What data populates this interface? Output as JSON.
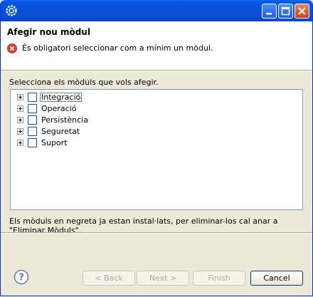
{
  "header": {
    "title": "Afegir nou mòdul",
    "error_message": "És obligatori seleccionar com a mínim un mòdul."
  },
  "prompt": "Selecciona els mòduls que vols afegir.",
  "tree": {
    "items": [
      {
        "label": "Integració",
        "checked": false
      },
      {
        "label": "Operació",
        "checked": false
      },
      {
        "label": "Persistència",
        "checked": false
      },
      {
        "label": "Seguretat",
        "checked": false
      },
      {
        "label": "Suport",
        "checked": false
      }
    ]
  },
  "info": "Els mòduls en negreta ja estan instal·lats, per eliminar-los cal anar a \"Eliminar Mòduls\".",
  "buttons": {
    "back": "< Back",
    "next": "Next >",
    "finish": "Finish",
    "cancel": "Cancel"
  },
  "colors": {
    "titlebar": "#0553d9",
    "error": "#d8402f",
    "help": "#6b7a99"
  }
}
